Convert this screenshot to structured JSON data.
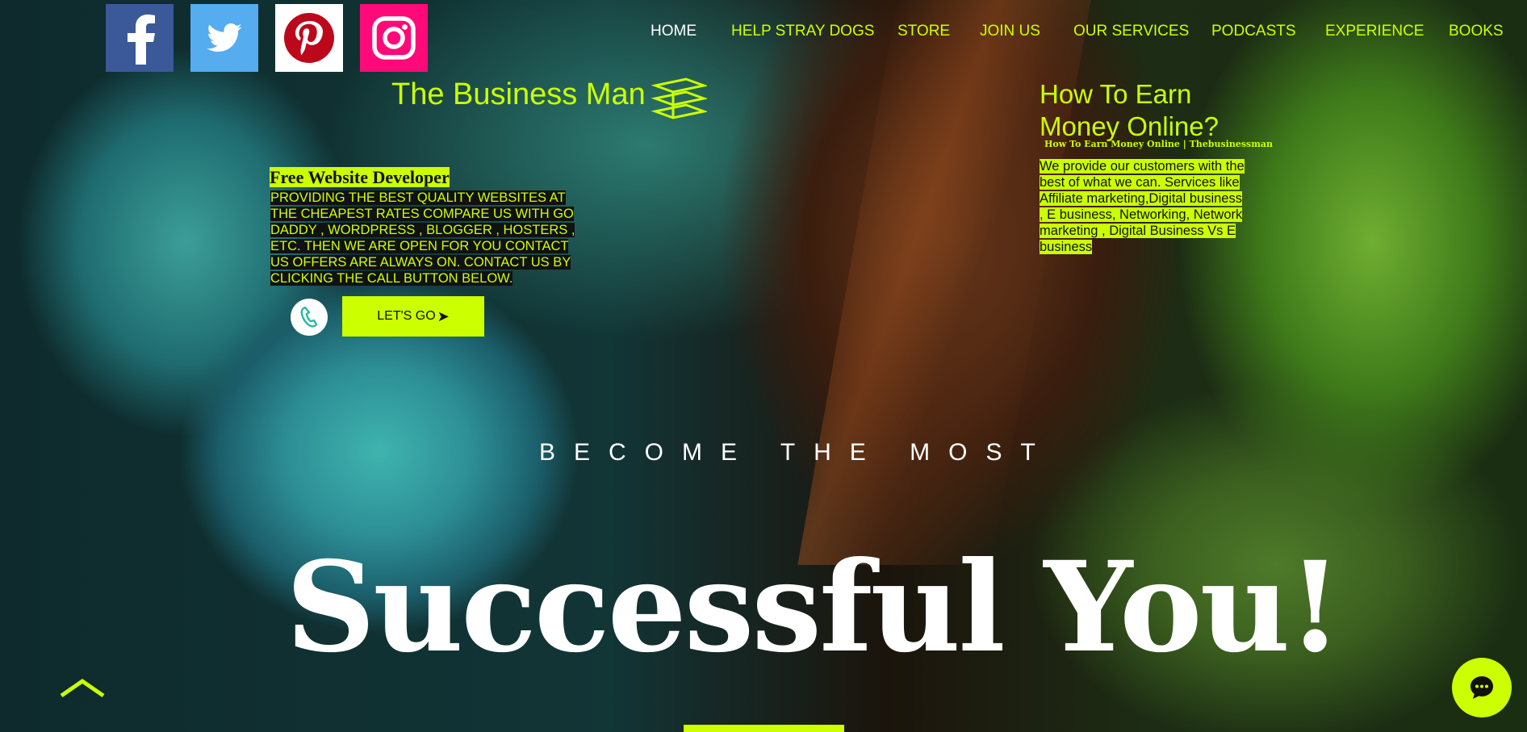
{
  "colors": {
    "accent": "#ccff00",
    "nav_active": "#ffffff",
    "facebook": "#3b5998",
    "twitter": "#55acee",
    "instagram": "#ff0a78",
    "pinterest": "#bd081c"
  },
  "social": {
    "facebook_icon": "facebook-icon",
    "twitter_icon": "twitter-icon",
    "pinterest_icon": "pinterest-icon",
    "instagram_icon": "instagram-icon"
  },
  "nav": {
    "items": [
      "HOME",
      "HELP STRAY DOGS",
      "STORE",
      "JOIN US",
      "OUR SERVICES",
      "PODCASTS",
      "EXPERIENCE",
      "BOOKS"
    ],
    "active": "HOME"
  },
  "brand": {
    "name": "The Business Man",
    "logo_icon": "brand-logo-icon"
  },
  "earn": {
    "title": "How To Earn Money Online?",
    "subtitle": "How To Earn Money Online | Thebusinessman",
    "body": "We provide our customers with the best of what we can. Services like Affiliate marketing,Digital business , E business, Networking, Network marketing , Digital Business Vs E  business"
  },
  "developer": {
    "title": "Free Website Developer",
    "body": " PROVIDING THE BEST QUALITY WEBSITES AT THE CHEAPEST RATES COMPARE US WITH GO DADDY , WORDPRESS , BLOGGER , HOSTERS , ETC. THEN WE ARE OPEN FOR YOU CONTACT US OFFERS ARE ALWAYS ON. CONTACT US BY CLICKING THE CALL BUTTON BELOW."
  },
  "cta": {
    "button_label": "LET'S GO",
    "call_icon": "phone-icon"
  },
  "hero": {
    "tagline": "BECOME THE MOST",
    "headline": "Successful You!"
  },
  "widgets": {
    "scroll_top_icon": "chevron-up-icon",
    "chat_icon": "chat-icon"
  }
}
